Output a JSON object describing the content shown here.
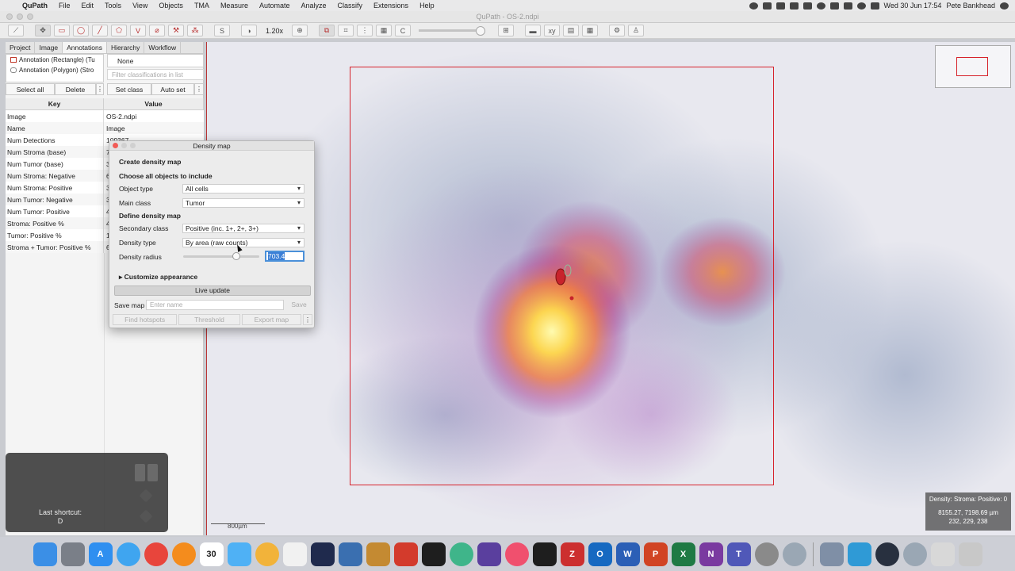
{
  "menubar": {
    "app": "QuPath",
    "items": [
      "File",
      "Edit",
      "Tools",
      "View",
      "Objects",
      "TMA",
      "Measure",
      "Automate",
      "Analyze",
      "Classify",
      "Extensions",
      "Help"
    ],
    "clock": "Wed 30 Jun  17:54",
    "user": "Pete Bankhead"
  },
  "window": {
    "title": "QuPath - OS-2.ndpi"
  },
  "toolbar": {
    "zoom": "1.20x",
    "s_label": "S",
    "c_label": "C"
  },
  "left_panel": {
    "tabs": [
      "Project",
      "Image",
      "Annotations",
      "Hierarchy",
      "Workflow"
    ],
    "active_tab": "Annotations",
    "annotations": [
      "Annotation (Rectangle) (Tu",
      "Annotation (Polygon) (Stro"
    ],
    "class_none": "None",
    "class_filter_placeholder": "Filter classifications in list",
    "select_all": "Select all",
    "delete": "Delete",
    "set_class": "Set class",
    "auto_set": "Auto set",
    "table_headers": {
      "key": "Key",
      "value": "Value"
    },
    "rows": [
      {
        "k": "Image",
        "v": "OS-2.ndpi"
      },
      {
        "k": "Name",
        "v": "Image"
      },
      {
        "k": "Num Detections",
        "v": "109367"
      },
      {
        "k": "Num Stroma (base)",
        "v": "7"
      },
      {
        "k": "Num Tumor (base)",
        "v": "3"
      },
      {
        "k": "Num Stroma: Negative",
        "v": "6"
      },
      {
        "k": "Num Stroma: Positive",
        "v": "3"
      },
      {
        "k": "Num Tumor: Negative",
        "v": "3"
      },
      {
        "k": "Num Tumor: Positive",
        "v": "4"
      },
      {
        "k": "Stroma: Positive %",
        "v": "4"
      },
      {
        "k": "Tumor: Positive %",
        "v": "1"
      },
      {
        "k": "Stroma + Tumor: Positive %",
        "v": "6"
      }
    ]
  },
  "shortcut": {
    "label": "Last shortcut:",
    "key": "D"
  },
  "dialog": {
    "title": "Density map",
    "create": "Create density map",
    "choose": "Choose all objects to include",
    "object_type_label": "Object type",
    "object_type": "All cells",
    "main_class_label": "Main class",
    "main_class": "Tumor",
    "define": "Define density map",
    "secondary_label": "Secondary class",
    "secondary": "Positive (inc. 1+, 2+, 3+)",
    "density_type_label": "Density type",
    "density_type": "By area (raw counts)",
    "radius_label": "Density radius",
    "radius_value": "703.4",
    "customize": "Customize appearance",
    "live_update": "Live update",
    "save_map_label": "Save map",
    "name_placeholder": "Enter name",
    "save": "Save",
    "find_hotspots": "Find hotspots",
    "threshold": "Threshold",
    "export_map": "Export map",
    "more": "⋮"
  },
  "viewer": {
    "scale_label": "800µm",
    "info_line1": "Density: Stroma: Positive: 0",
    "info_line2": "8155.27, 7198.69 µm",
    "info_line3": "232, 229, 238"
  },
  "dock": {
    "calendar_day": "30",
    "apps": [
      "finder-icon",
      "launchpad-icon",
      "appstore-icon",
      "safari-icon",
      "chrome-icon",
      "firefox-icon",
      "calendar-icon",
      "messages-icon",
      "photos-icon",
      "notes-icon",
      "terminal-icon",
      "word-icon",
      "excel-icon",
      "powerpoint-icon",
      "outlook-icon",
      "trash-icon"
    ]
  },
  "colors": {
    "roi": "#d6232c",
    "accent": "#3b7fd6"
  }
}
